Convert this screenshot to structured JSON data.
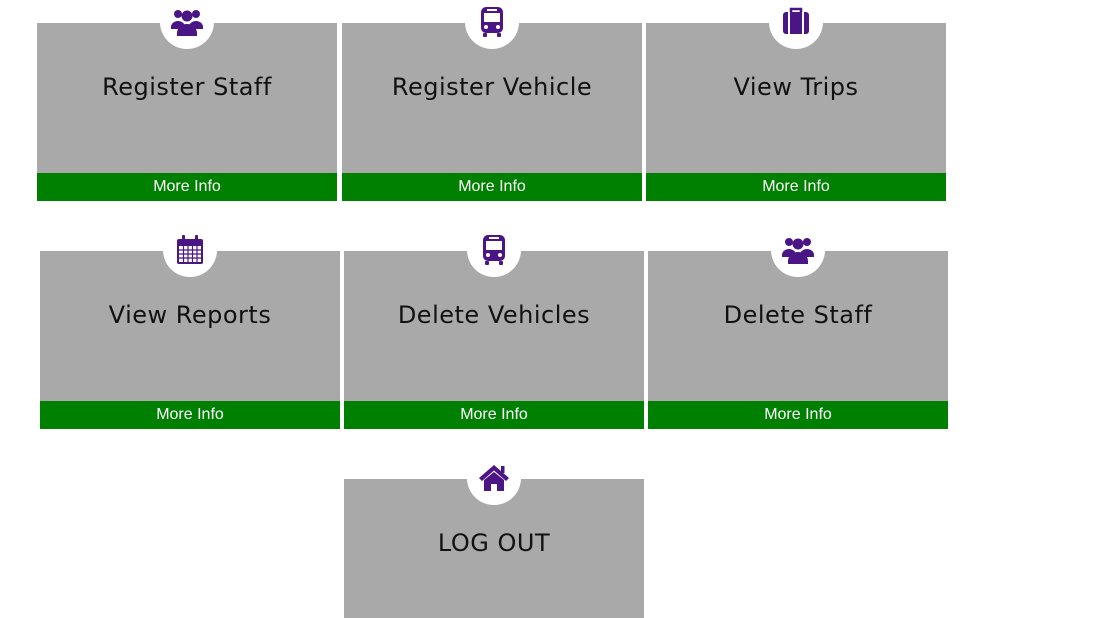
{
  "colors": {
    "card_bg": "#a9a9a9",
    "footer_bg": "#008000",
    "icon": "#4b1585",
    "footer_text": "#ffffff"
  },
  "cards": [
    {
      "title": "Register Staff",
      "footer": "More Info",
      "icon": "users-icon"
    },
    {
      "title": "Register Vehicle",
      "footer": "More Info",
      "icon": "bus-icon"
    },
    {
      "title": "View Trips",
      "footer": "More Info",
      "icon": "suitcase-icon"
    },
    {
      "title": "View Reports",
      "footer": "More Info",
      "icon": "calendar-icon"
    },
    {
      "title": "Delete Vehicles",
      "footer": "More Info",
      "icon": "bus-icon"
    },
    {
      "title": "Delete Staff",
      "footer": "More Info",
      "icon": "users-icon"
    }
  ],
  "logout": {
    "title": "LOG OUT",
    "icon": "home-icon"
  }
}
